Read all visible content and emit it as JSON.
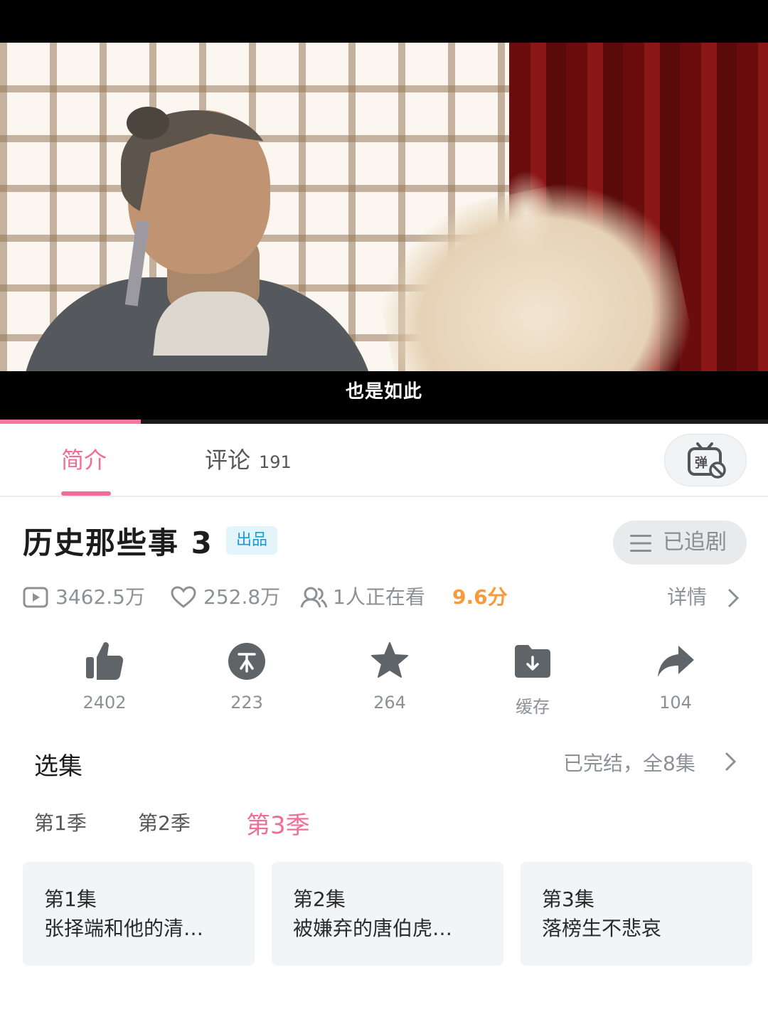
{
  "player": {
    "subtitle": "也是如此",
    "progress": 0.183
  },
  "tabs": {
    "intro": "简介",
    "comments": "评论",
    "comments_count": "191",
    "danmaku_icon": "danmaku-off-icon"
  },
  "show": {
    "title": "历史那些事 3",
    "badge": "出品",
    "follow_label": "已追剧"
  },
  "stats": {
    "plays": "3462.5万",
    "likes": "252.8万",
    "watching": "1人正在看",
    "score": "9.6分",
    "detail": "详情"
  },
  "actions": [
    {
      "icon": "thumbs-up-icon",
      "label": "2402"
    },
    {
      "icon": "coin-icon",
      "label": "223"
    },
    {
      "icon": "star-icon",
      "label": "264"
    },
    {
      "icon": "download-folder-icon",
      "label": "缓存"
    },
    {
      "icon": "share-icon",
      "label": "104"
    }
  ],
  "episodes": {
    "title": "选集",
    "status": "已完结，全8集",
    "seasons": [
      "第1季",
      "第2季",
      "第3季"
    ],
    "selected_season": "第3季",
    "items": [
      {
        "num": "第1集",
        "name": "张择端和他的清…"
      },
      {
        "num": "第2集",
        "name": "被嫌弃的唐伯虎…"
      },
      {
        "num": "第3集",
        "name": "落榜生不悲哀"
      }
    ]
  },
  "colors": {
    "accent": "#f26d95",
    "score": "#f79a3a",
    "badge": "#1b9ad6"
  }
}
